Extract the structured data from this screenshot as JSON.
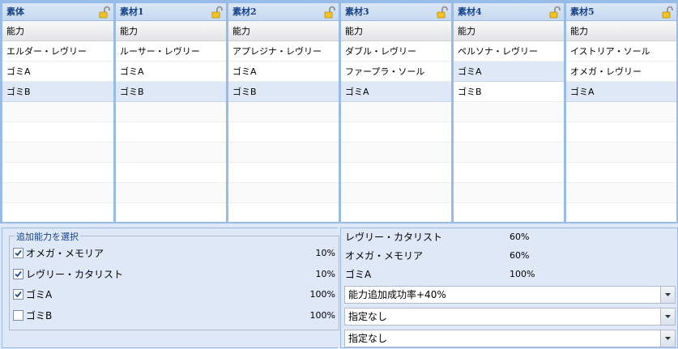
{
  "columns": [
    {
      "title": "素体",
      "ability_header": "能力",
      "rows": [
        "エルダー・レヴリー",
        "ゴミA",
        "ゴミB"
      ],
      "selected_row": 2
    },
    {
      "title": "素材1",
      "ability_header": "能力",
      "rows": [
        "ルーサー・レヴリー",
        "ゴミA",
        "ゴミB"
      ],
      "selected_row": 2
    },
    {
      "title": "素材2",
      "ability_header": "能力",
      "rows": [
        "アプレジナ・レヴリー",
        "ゴミA",
        "ゴミB"
      ],
      "selected_row": 2
    },
    {
      "title": "素材3",
      "ability_header": "能力",
      "rows": [
        "ダブル・レヴリー",
        "ファープラ・ソール",
        "ゴミA"
      ],
      "selected_row": 2
    },
    {
      "title": "素材4",
      "ability_header": "能力",
      "rows": [
        "ペルソナ・レヴリー",
        "ゴミA",
        "ゴミB"
      ],
      "selected_row": 1
    },
    {
      "title": "素材5",
      "ability_header": "能力",
      "rows": [
        "イストリア・ソール",
        "オメガ・レヴリー",
        "ゴミA"
      ],
      "selected_row": 2
    }
  ],
  "additional": {
    "legend": "追加能力を選択",
    "items": [
      {
        "label": "オメガ・メモリア",
        "percent": "10%",
        "checked": true
      },
      {
        "label": "レヴリー・カタリスト",
        "percent": "10%",
        "checked": true
      },
      {
        "label": "ゴミA",
        "percent": "100%",
        "checked": true
      },
      {
        "label": "ゴミB",
        "percent": "100%",
        "checked": false
      }
    ]
  },
  "summary": {
    "items": [
      {
        "label": "レヴリー・カタリスト",
        "value": "60%"
      },
      {
        "label": "オメガ・メモリア",
        "value": "60%"
      },
      {
        "label": "ゴミA",
        "value": "100%"
      }
    ],
    "selects": [
      {
        "value": "能力追加成功率+40%"
      },
      {
        "value": "指定なし"
      },
      {
        "value": "指定なし"
      }
    ]
  },
  "colors": {
    "header_text": "#15428b",
    "selected_row": "#dfe8f6",
    "border": "#99bbe8"
  }
}
